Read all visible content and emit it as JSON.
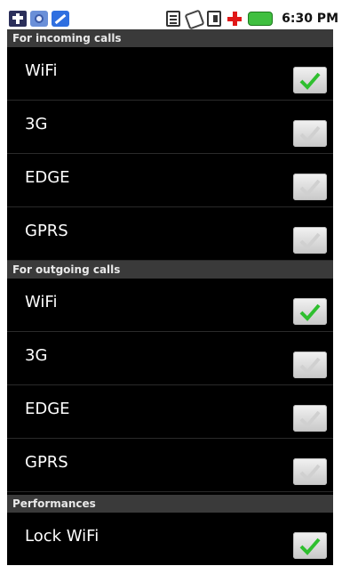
{
  "statusbar": {
    "icons": [
      "usb-icon",
      "settings-icon",
      "edit-icon",
      "signal-icon",
      "wifi-icon",
      "sim-icon",
      "plus-icon",
      "battery-icon"
    ],
    "time": "6:30 PM"
  },
  "sections": [
    {
      "title": "For incoming calls",
      "items": [
        {
          "label": "WiFi",
          "checked": true
        },
        {
          "label": "3G",
          "checked": false
        },
        {
          "label": "EDGE",
          "checked": false
        },
        {
          "label": "GPRS",
          "checked": false
        }
      ]
    },
    {
      "title": "For outgoing calls",
      "items": [
        {
          "label": "WiFi",
          "checked": true
        },
        {
          "label": "3G",
          "checked": false
        },
        {
          "label": "EDGE",
          "checked": false
        },
        {
          "label": "GPRS",
          "checked": false
        }
      ]
    },
    {
      "title": "Performances",
      "items": [
        {
          "label": "Lock WiFi",
          "checked": true
        }
      ]
    }
  ],
  "colors": {
    "checked": "#2fbf2f",
    "unchecked": "#d0d0d0",
    "header_bg": "#3a3a3a",
    "list_bg": "#000000"
  }
}
